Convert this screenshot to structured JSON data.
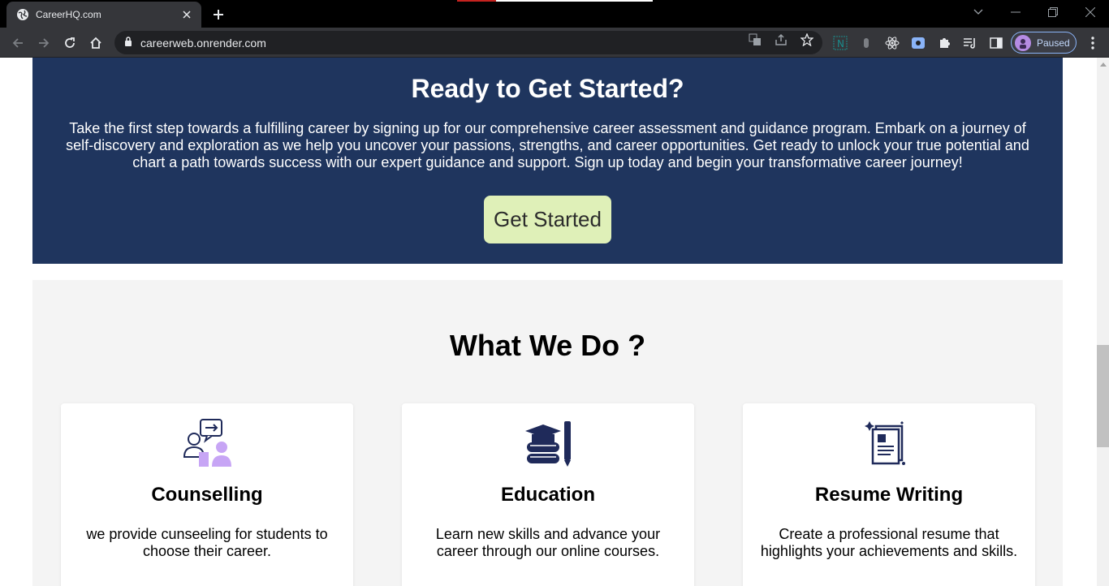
{
  "browser": {
    "tab_title": "CareerHQ.com",
    "url": "careerweb.onrender.com",
    "profile_label": "Paused"
  },
  "hero": {
    "title": "Ready to Get Started?",
    "description": "Take the first step towards a fulfilling career by signing up for our comprehensive career assessment and guidance program. Embark on a journey of self-discovery and exploration as we help you uncover your passions, strengths, and career opportunities. Get ready to unlock your true potential and chart a path towards success with our expert guidance and support. Sign up today and begin your transformative career journey!",
    "cta_label": "Get Started",
    "background": "#1f355e",
    "cta_color": "#dff0b8"
  },
  "services": {
    "title": "What We Do ?",
    "cards": [
      {
        "title": "Counselling",
        "text": "we provide cunseeling for students to choose their career.",
        "icon": "counselling-icon"
      },
      {
        "title": "Education",
        "text": "Learn new skills and advance your career through our online courses.",
        "icon": "education-icon"
      },
      {
        "title": "Resume Writing",
        "text": "Create a professional resume that highlights your achievements and skills.",
        "icon": "resume-icon"
      }
    ]
  }
}
